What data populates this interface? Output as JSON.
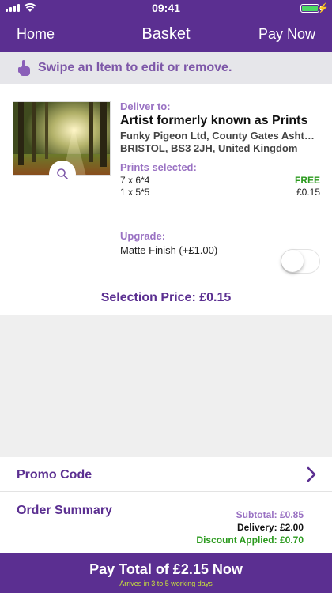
{
  "status_bar": {
    "time": "09:41",
    "battery_level": 1.0
  },
  "nav": {
    "left": "Home",
    "title": "Basket",
    "right": "Pay Now"
  },
  "hint": {
    "icon": "swipe-hand-icon",
    "text": "Swipe an Item to edit or remove."
  },
  "item": {
    "thumbnail": "forest-photo",
    "deliver_label": "Deliver to:",
    "name": "Artist formerly known as Prints",
    "address_line1": "Funky Pigeon Ltd, County Gates  Ashton Vale Road",
    "address_line2": "BRISTOL, BS3 2JH, United Kingdom",
    "prints_label": "Prints selected:",
    "prints": [
      {
        "size": "7 x 6*4",
        "price": "FREE"
      },
      {
        "size": "1 x 5*5",
        "price": "£0.15"
      }
    ],
    "upgrade_label": "Upgrade:",
    "upgrade_option": "Matte Finish (+£1.00)",
    "upgrade_enabled": false,
    "selection_price": "Selection Price: £0.15"
  },
  "promo": {
    "label": "Promo Code"
  },
  "summary": {
    "label": "Order Summary",
    "subtotal": "Subtotal: £0.85",
    "delivery": "Delivery: £2.00",
    "discount": "Discount Applied: £0.70"
  },
  "pay": {
    "label": "Pay Total of £2.15 Now",
    "sub": "Arrives in 3 to 5 working days"
  },
  "colors": {
    "brand": "#5b2f91",
    "accent": "#9a72c3",
    "free": "#2b9a1e",
    "sub_text": "#c8e23c"
  }
}
